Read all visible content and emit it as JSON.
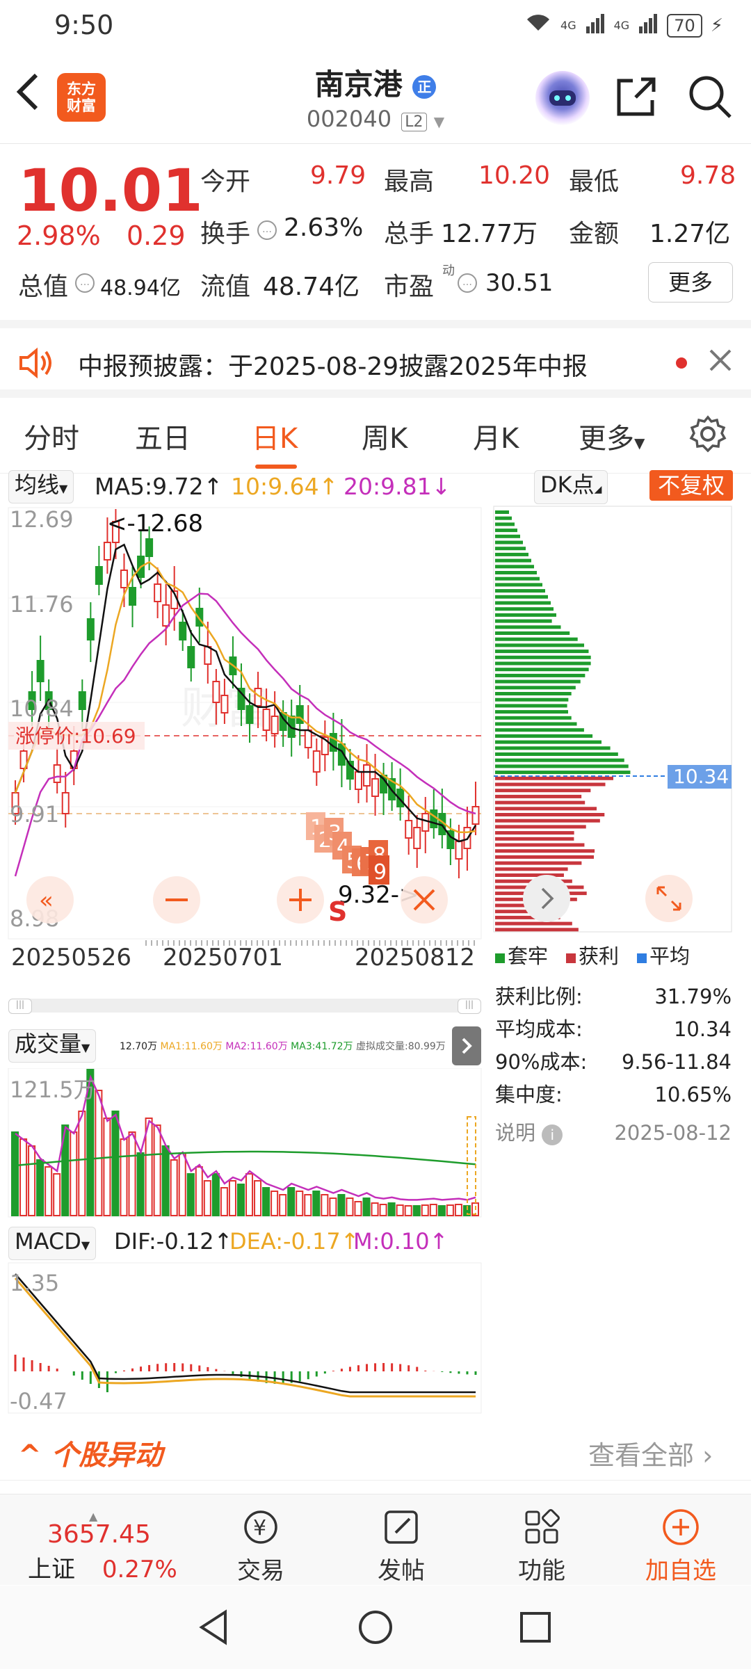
{
  "status_bar": {
    "time": "9:50",
    "signal1": "4G",
    "signal2": "4G",
    "battery": "70"
  },
  "header": {
    "logo_line1": "东方",
    "logo_line2": "财富",
    "stock_name": "南京港",
    "badge": "正",
    "stock_code": "002040",
    "level": "L2"
  },
  "quote": {
    "price": "10.01",
    "change_pct": "2.98%",
    "change_abs": "0.29",
    "open_label": "今开",
    "open": "9.79",
    "high_label": "最高",
    "high": "10.20",
    "low_label": "最低",
    "low": "9.78",
    "turnover_label": "换手",
    "turnover": "2.63%",
    "volume_label": "总手",
    "volume": "12.77万",
    "amount_label": "金额",
    "amount": "1.27亿",
    "mktcap_label": "总值",
    "mktcap": "48.94亿",
    "float_label": "流值",
    "float_cap": "48.74亿",
    "pe_label": "市盈",
    "pe_sup": "动",
    "pe": "30.51",
    "more_label": "更多"
  },
  "notice": {
    "text": "中报预披露：于2025-08-29披露2025年中报"
  },
  "tabs": [
    {
      "label": "分时"
    },
    {
      "label": "五日"
    },
    {
      "label": "日K"
    },
    {
      "label": "周K"
    },
    {
      "label": "月K"
    },
    {
      "label": "更多"
    }
  ],
  "kline": {
    "indicator_select": "均线",
    "ma5": "MA5:9.72↑",
    "ma10": "10:9.64↑",
    "ma20": "20:9.81↓",
    "dk_label": "DK点",
    "adjust_label": "不复权",
    "y_labels": [
      "12.69",
      "11.76",
      "10.84",
      "9.91",
      "8.98"
    ],
    "limit_label": "涨停价:10.69",
    "high_marker": "<-12.68",
    "low_marker": "9.32->",
    "sell_marker": "S",
    "x_labels": [
      "20250526",
      "20250701",
      "20250812"
    ],
    "watermark": "财富",
    "seq_labels": [
      "1",
      "2",
      "3",
      "4",
      "5",
      "6",
      "7",
      "8",
      "9"
    ]
  },
  "chip_dist": {
    "avg_label": "10.34",
    "legend": [
      "套牢",
      "获利",
      "平均"
    ],
    "colors": {
      "trapped": "#1e9c2c",
      "profit": "#c8363d",
      "avg": "#2f7de1"
    },
    "rows": [
      {
        "label": "获利比例:",
        "value": "31.79%"
      },
      {
        "label": "平均成本:",
        "value": "10.34"
      },
      {
        "label": "90%成本:",
        "value": "9.56-11.84"
      },
      {
        "label": "集中度:",
        "value": "10.65%"
      }
    ],
    "note_label": "说明",
    "date": "2025-08-12"
  },
  "volume": {
    "select_label": "成交量",
    "stats": "12.70万",
    "ma1": "MA1:11.60万",
    "ma2": "MA2:11.60万",
    "ma3": "MA3:41.72万",
    "virtual": "虚拟成交量:80.99万",
    "y_top": "121.5万"
  },
  "macd": {
    "select_label": "MACD",
    "dif": "DIF:-0.12↑",
    "dea": "DEA:-0.17↑",
    "m": "M:0.10↑",
    "y_top": "1.35",
    "y_bottom": "-0.47"
  },
  "movement": {
    "title": "个股异动",
    "view_all": "查看全部"
  },
  "bottom_nav": {
    "index_value": "3657.45",
    "index_name": "上证",
    "index_change": "0.27%",
    "items": [
      {
        "label": "交易"
      },
      {
        "label": "发帖"
      },
      {
        "label": "功能"
      },
      {
        "label": "加自选"
      }
    ]
  }
}
